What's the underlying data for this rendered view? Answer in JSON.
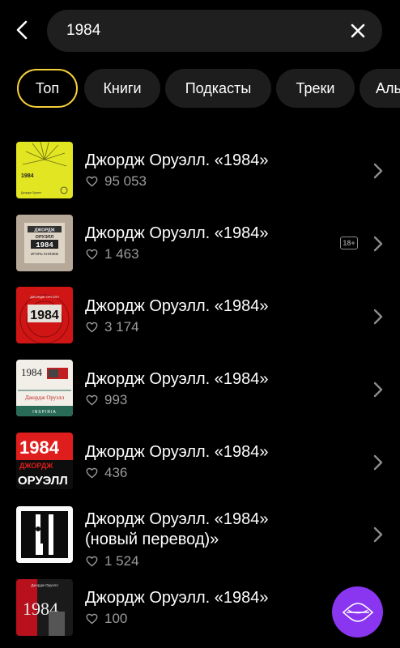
{
  "search": {
    "query": "1984"
  },
  "filters": [
    "Топ",
    "Книги",
    "Подкасты",
    "Треки",
    "Аль"
  ],
  "results": [
    {
      "title": "Джордж Оруэлл. «1984»",
      "likes": "95 053"
    },
    {
      "title": "Джордж Оруэлл. «1984»",
      "likes": "1 463",
      "badge": "18+"
    },
    {
      "title": "Джордж Оруэлл. «1984»",
      "likes": "3 174"
    },
    {
      "title": "Джордж Оруэлл. «1984»",
      "likes": "993"
    },
    {
      "title": "Джордж Оруэлл. «1984»",
      "likes": "436"
    },
    {
      "title": "Джордж Оруэлл. «1984»",
      "title2": "(новый перевод)»",
      "likes": "1 524"
    },
    {
      "title": "Джордж Оруэлл. «1984»",
      "likes": "100"
    }
  ],
  "covers": [
    {
      "text": "1984",
      "author": "Джордж Оруэлл"
    },
    {
      "author": "ДЖОРДЖ",
      "name": "ОРУЭЛЛ",
      "text": "1984",
      "reader": "ИГОРЬ КНЯЗЕВ"
    },
    {
      "author": "ДЖОРДЖ ОРУЭЛЛ",
      "text": "1984"
    },
    {
      "text": "1984",
      "author": "Джордж Оруэлл",
      "publisher": "INSPIRIA"
    },
    {
      "text": "1984",
      "author": "ДЖОРДЖ",
      "name": "ОРУЭЛЛ"
    },
    {},
    {
      "author": "Джордж Оруэлл",
      "text": "1984"
    }
  ],
  "icons": {
    "back": "back-arrow-icon",
    "clear": "close-icon",
    "like": "heart-icon",
    "chevron": "chevron-right-icon",
    "fab": "assistant-wave-icon"
  },
  "colors": {
    "accent": "#f5cf3a",
    "fab": "#8a35f0",
    "muted": "#9b9b9b"
  }
}
